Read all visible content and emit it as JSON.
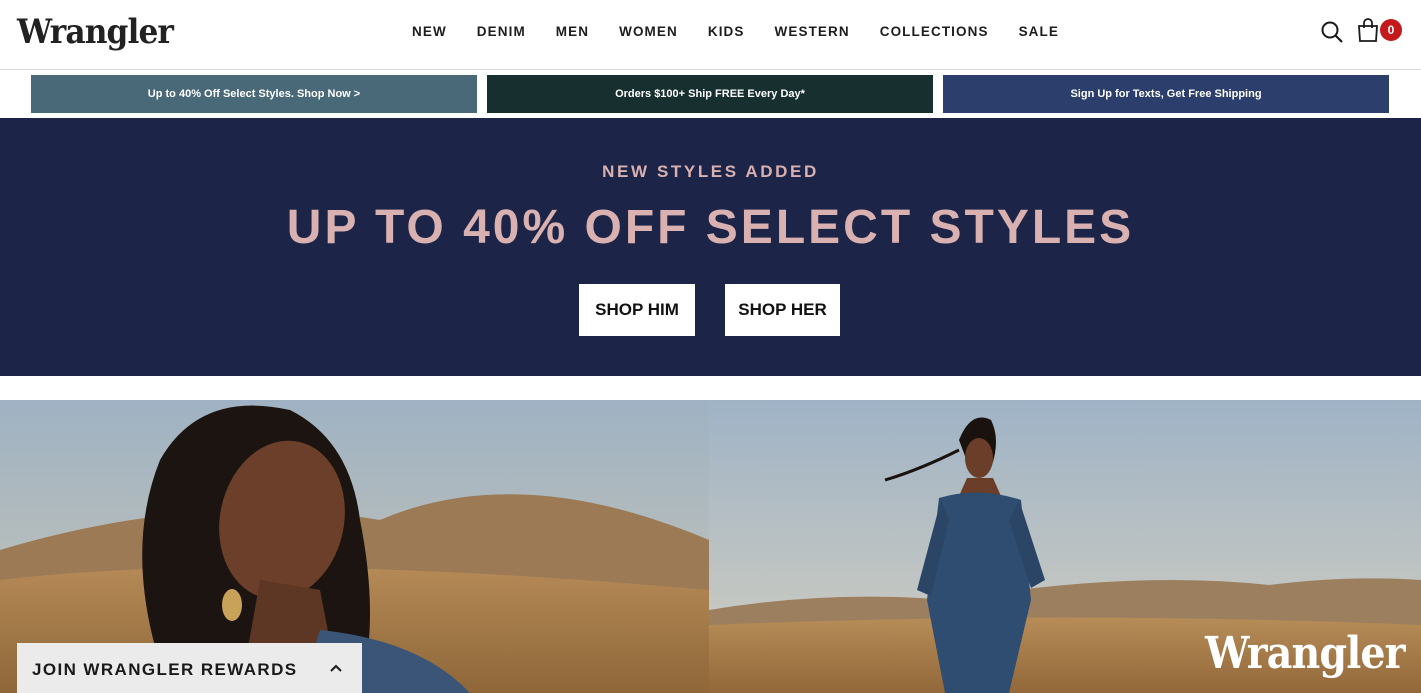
{
  "header": {
    "logo": "Wrangler",
    "nav": [
      "NEW",
      "DENIM",
      "MEN",
      "WOMEN",
      "KIDS",
      "WESTERN",
      "COLLECTIONS",
      "SALE"
    ],
    "search_icon": "search-icon",
    "bag_icon": "shopping-bag-icon",
    "bag_count": "0"
  },
  "promos": [
    {
      "text": "Up to 40% Off Select Styles. Shop Now >",
      "color": "#4a6978"
    },
    {
      "text": "Orders $100+ Ship FREE Every Day*",
      "color": "#17302f"
    },
    {
      "text": "Sign Up for Texts, Get Free Shipping",
      "color": "#2c3e6c"
    }
  ],
  "hero": {
    "eyebrow": "NEW STYLES ADDED",
    "headline": "UP TO 40% OFF SELECT STYLES",
    "buttons": [
      "SHOP HIM",
      "SHOP HER"
    ],
    "background": "#1c2447",
    "accent": "#d9b1b1"
  },
  "images": {
    "overlay_logo": "Wrangler"
  },
  "rewards": {
    "label": "JOIN WRANGLER REWARDS",
    "icon": "chevron-up-icon"
  }
}
